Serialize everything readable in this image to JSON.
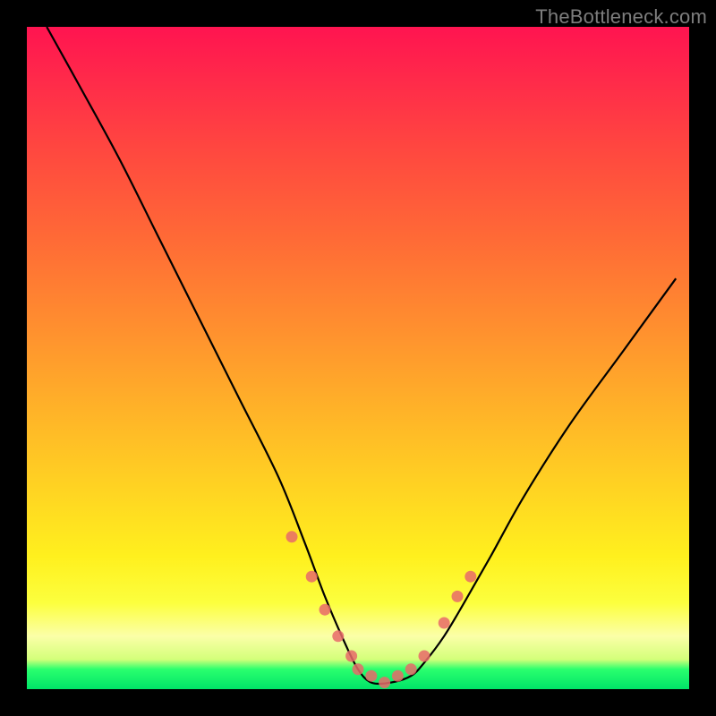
{
  "watermark": "TheBottleneck.com",
  "chart_data": {
    "type": "line",
    "title": "",
    "xlabel": "",
    "ylabel": "",
    "xlim": [
      0,
      100
    ],
    "ylim": [
      0,
      100
    ],
    "series": [
      {
        "name": "curve",
        "x": [
          3,
          8,
          14,
          20,
          26,
          32,
          38,
          42,
          45,
          48,
          50,
          52,
          55,
          58,
          60,
          63,
          66,
          70,
          75,
          82,
          90,
          98
        ],
        "values": [
          100,
          91,
          80,
          68,
          56,
          44,
          32,
          22,
          14,
          7,
          3,
          1,
          1,
          2,
          4,
          8,
          13,
          20,
          29,
          40,
          51,
          62
        ]
      }
    ],
    "markers": {
      "name": "highlight-dots",
      "color": "#e86a6a",
      "x": [
        40,
        43,
        45,
        47,
        49,
        50,
        52,
        54,
        56,
        58,
        60,
        63,
        65,
        67
      ],
      "values": [
        23,
        17,
        12,
        8,
        5,
        3,
        2,
        1,
        2,
        3,
        5,
        10,
        14,
        17
      ]
    },
    "gradient_stops": [
      {
        "pos": 0,
        "color": "#ff1450"
      },
      {
        "pos": 45,
        "color": "#ff8e2f"
      },
      {
        "pos": 80,
        "color": "#fff01e"
      },
      {
        "pos": 97,
        "color": "#2aff6e"
      },
      {
        "pos": 100,
        "color": "#00e468"
      }
    ]
  }
}
